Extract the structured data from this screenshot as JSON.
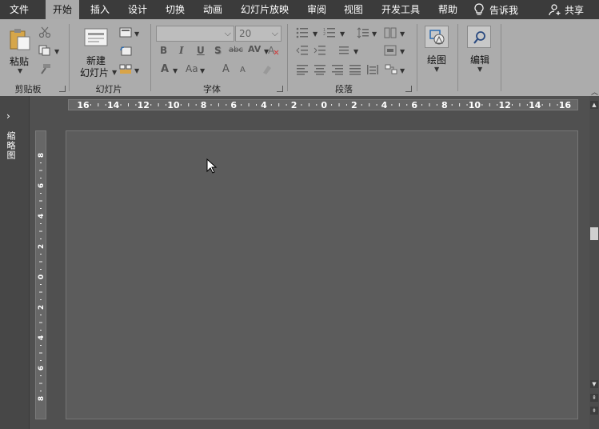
{
  "tabs": [
    "文件",
    "开始",
    "插入",
    "设计",
    "切换",
    "动画",
    "幻灯片放映",
    "审阅",
    "视图",
    "开发工具",
    "帮助"
  ],
  "active_tab": "开始",
  "tell_me": "告诉我",
  "share": "共享",
  "groups": {
    "clipboard": {
      "label": "剪贴板",
      "paste": "粘贴"
    },
    "slides": {
      "label": "幻灯片",
      "new_slide_line1": "新建",
      "new_slide_line2": "幻灯片"
    },
    "font": {
      "label": "字体",
      "font_size": "20",
      "bold": "B",
      "italic": "I",
      "underline": "U",
      "shadow": "S",
      "strike": "abc",
      "spacing": "AV",
      "font_color": "A",
      "change_case": "Aa",
      "grow": "A",
      "shrink": "A"
    },
    "paragraph": {
      "label": "段落"
    },
    "drawing": {
      "label": "绘图"
    },
    "editing": {
      "label": "编辑"
    }
  },
  "thumbnail_pane": {
    "label": "缩略图"
  },
  "hruler": [
    "16",
    "14",
    "12",
    "10",
    "8",
    "6",
    "4",
    "2",
    "0",
    "2",
    "4",
    "6",
    "8",
    "10",
    "12",
    "14",
    "16"
  ],
  "vruler": [
    "8",
    "6",
    "4",
    "2",
    "0",
    "2",
    "4",
    "6",
    "8"
  ],
  "colors": {
    "tabbar": "#3b3b3b",
    "ribbon": "#acacac",
    "workspace": "#505050",
    "slide": "#5c5c5c"
  }
}
